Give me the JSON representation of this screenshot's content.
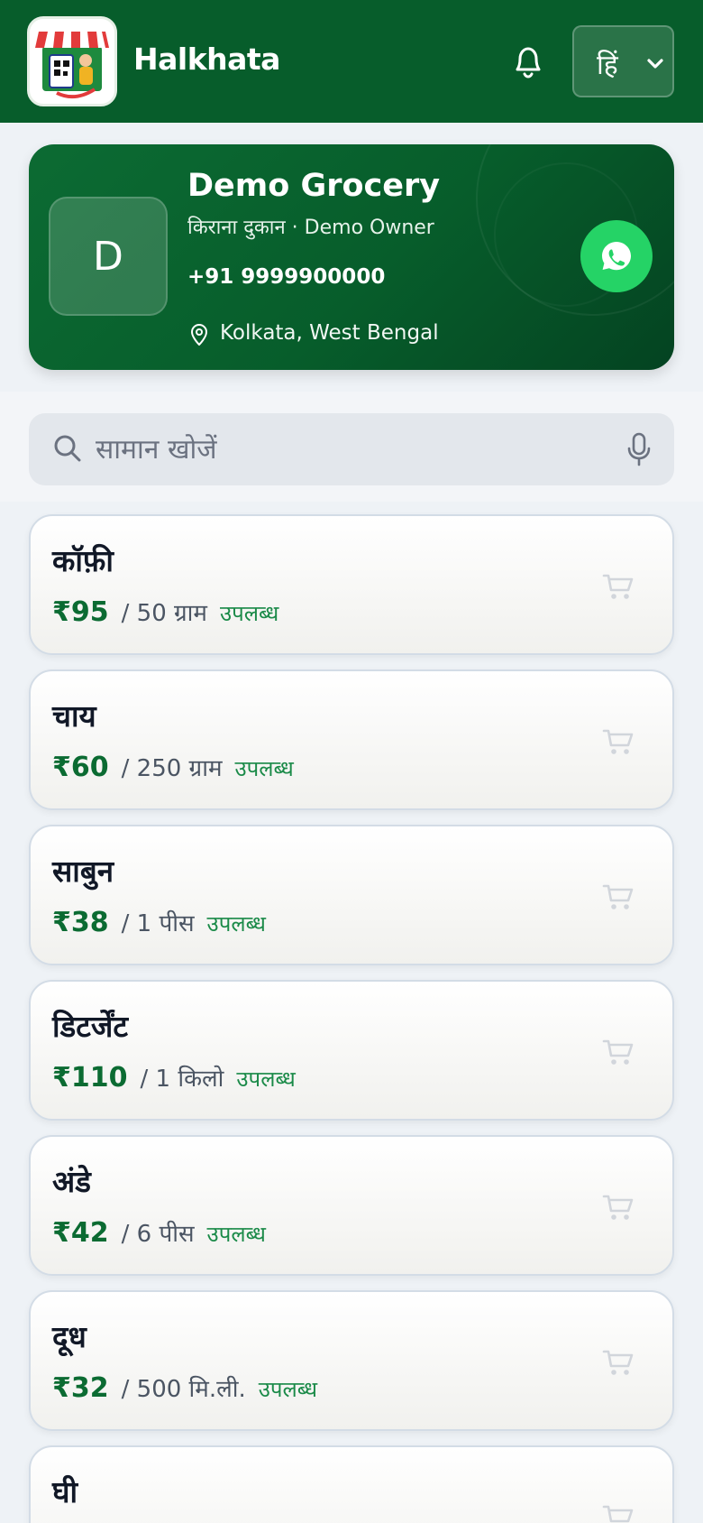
{
  "header": {
    "brand": "Halkhata",
    "language": "हिं",
    "colors": {
      "bar": "#075d2b",
      "accent": "#0b6b32"
    }
  },
  "shop": {
    "initial": "D",
    "name": "Demo Grocery",
    "subtitle": "किराना दुकान · Demo Owner",
    "phone": "+91 9999900000",
    "location": "Kolkata, West Bengal",
    "action_icon": "whatsapp-icon"
  },
  "search": {
    "placeholder": "सामान खोजें",
    "value": ""
  },
  "products": [
    {
      "name": "कॉफ़ी",
      "price": "₹95",
      "unit": "/ 50 ग्राम",
      "status": "उपलब्ध"
    },
    {
      "name": "चाय",
      "price": "₹60",
      "unit": "/ 250 ग्राम",
      "status": "उपलब्ध"
    },
    {
      "name": "साबुन",
      "price": "₹38",
      "unit": "/ 1 पीस",
      "status": "उपलब्ध"
    },
    {
      "name": "डिटर्जेंट",
      "price": "₹110",
      "unit": "/ 1 किलो",
      "status": "उपलब्ध"
    },
    {
      "name": "अंडे",
      "price": "₹42",
      "unit": "/ 6 पीस",
      "status": "उपलब्ध"
    },
    {
      "name": "दूध",
      "price": "₹32",
      "unit": "/ 500 मि.ली.",
      "status": "उपलब्ध"
    },
    {
      "name": "घी"
    }
  ]
}
